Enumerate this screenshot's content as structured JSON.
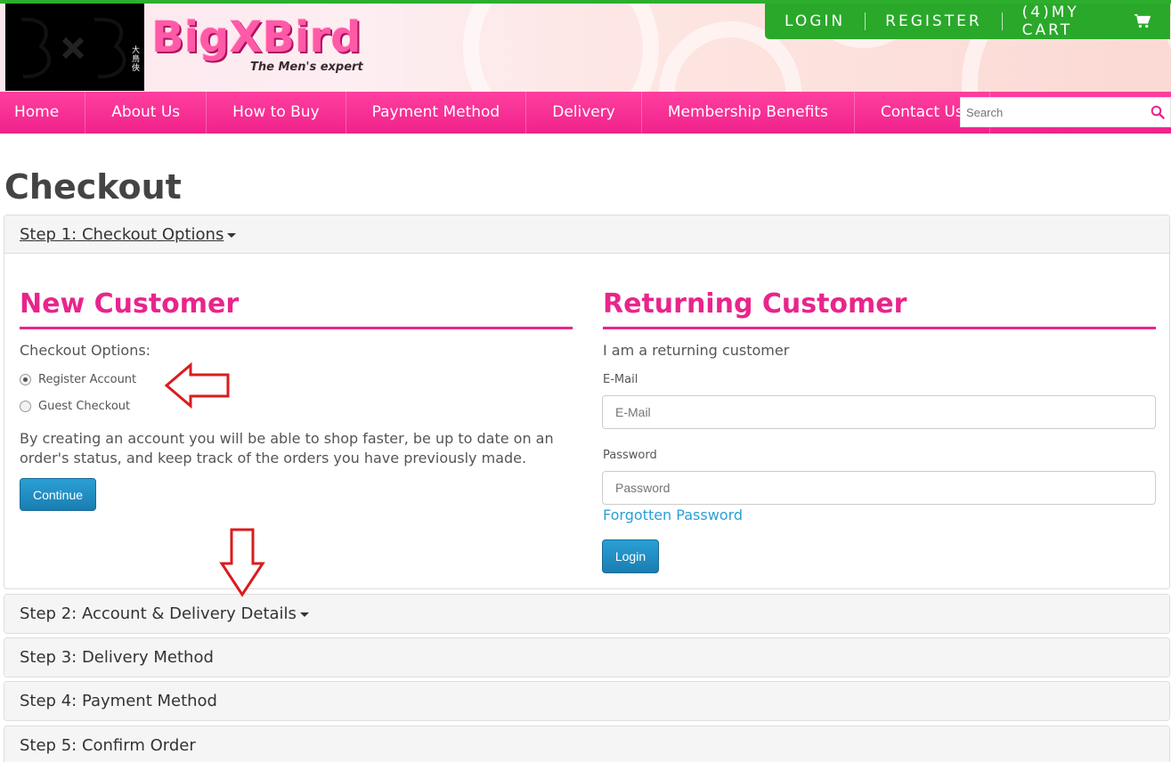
{
  "brand": {
    "name": "BigXBird",
    "tagline": "The Men's expert",
    "logo_chars": "大鳥俠"
  },
  "account_bar": {
    "login": "LOGIN",
    "register": "REGISTER",
    "cart": "(4)MY CART",
    "cart_icon": "shopping-cart-icon"
  },
  "nav": {
    "items": [
      "Home",
      "About Us",
      "How to Buy",
      "Payment Method",
      "Delivery",
      "Membership Benefits",
      "Contact Us"
    ],
    "search_placeholder": "Search",
    "search_icon": "search-icon"
  },
  "page": {
    "title": "Checkout"
  },
  "steps": {
    "step1": "Step 1: Checkout Options",
    "step2": "Step 2: Account & Delivery Details",
    "step3": "Step 3: Delivery Method",
    "step4": "Step 4: Payment Method",
    "step5": "Step 5: Confirm Order"
  },
  "new_customer": {
    "title": "New Customer",
    "options_label": "Checkout Options:",
    "option_register": "Register Account",
    "option_guest": "Guest Checkout",
    "selected": "Register Account",
    "description": "By creating an account you will be able to shop faster, be up to date on an order's status, and keep track of the orders you have previously made.",
    "continue_label": "Continue"
  },
  "returning_customer": {
    "title": "Returning Customer",
    "intro": "I am a returning customer",
    "email_label": "E-Mail",
    "email_placeholder": "E-Mail",
    "password_label": "Password",
    "password_placeholder": "Password",
    "forgotten": "Forgotten Password",
    "login_label": "Login"
  },
  "colors": {
    "brand_pink": "#e8258c",
    "nav_pink": "#f0228a",
    "account_green": "#2aa82a",
    "button_blue": "#2a9fd6",
    "annotation_red": "#d91c1c"
  }
}
